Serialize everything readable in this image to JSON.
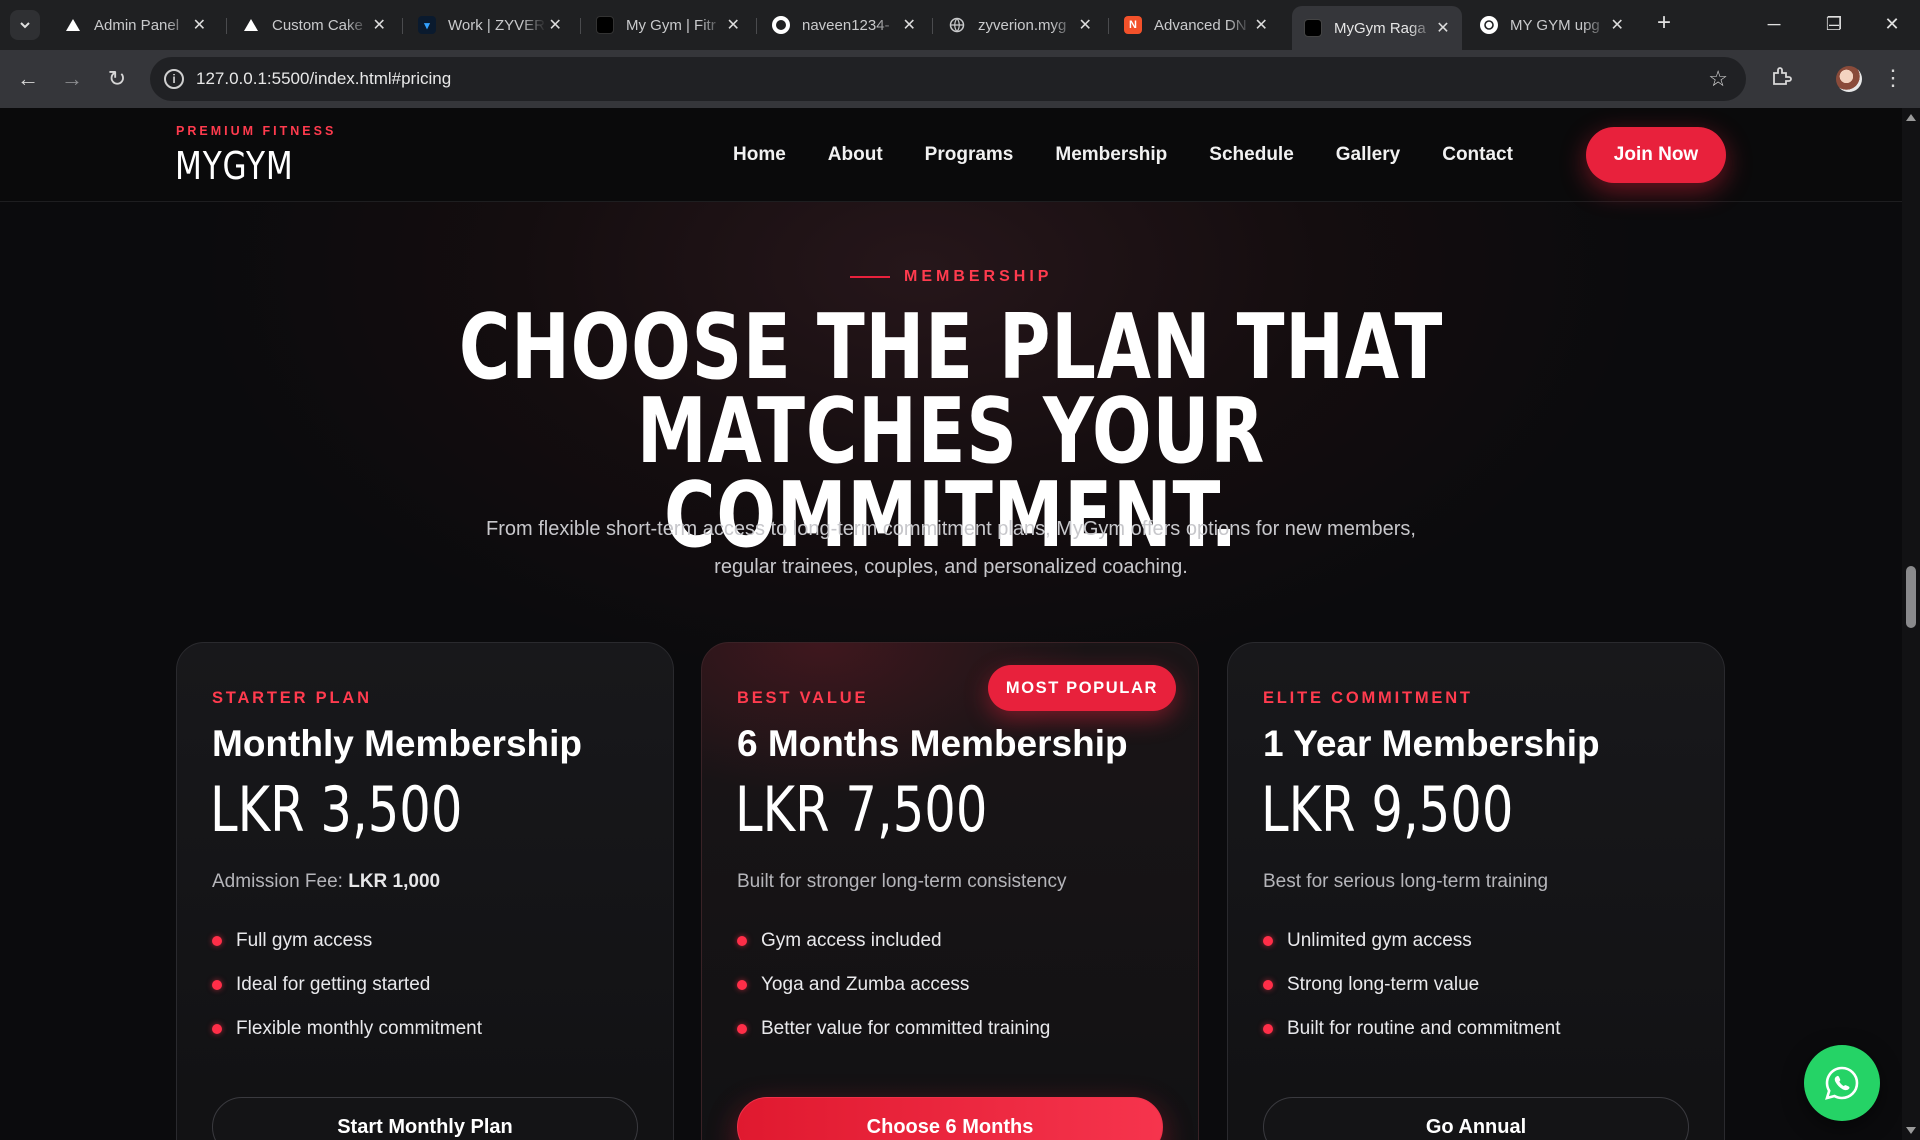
{
  "browser": {
    "tabs": [
      {
        "title": "Admin Panel",
        "favicon": "triangle-logo-icon",
        "active": false
      },
      {
        "title": "Custom Cake",
        "favicon": "triangle-logo-icon",
        "active": false
      },
      {
        "title": "Work | ZYVER",
        "favicon": "zyver-icon",
        "active": false
      },
      {
        "title": "My Gym | Fitr",
        "favicon": "mygym-icon",
        "active": false
      },
      {
        "title": "naveen1234-",
        "favicon": "github-icon",
        "active": false
      },
      {
        "title": "zyverion.myg",
        "favicon": "globe-icon",
        "active": false
      },
      {
        "title": "Advanced DN",
        "favicon": "n-logo-icon",
        "active": false
      },
      {
        "title": "MyGym Raga",
        "favicon": "mygym-icon",
        "active": true
      },
      {
        "title": "MY GYM upg",
        "favicon": "openai-icon",
        "active": false
      }
    ],
    "url": "127.0.0.1:5500/index.html#pricing"
  },
  "site": {
    "brand_tag": "PREMIUM FITNESS",
    "brand_name": "MYGYM",
    "nav": [
      "Home",
      "About",
      "Programs",
      "Membership",
      "Schedule",
      "Gallery",
      "Contact"
    ],
    "join_label": "Join Now"
  },
  "section": {
    "eyebrow": "MEMBERSHIP",
    "headline": "CHOOSE THE PLAN THAT MATCHES YOUR COMMITMENT.",
    "lead": "From flexible short-term access to long-term commitment plans, MyGym offers options for new members, regular trainees, couples, and personalized coaching."
  },
  "plans": [
    {
      "kicker": "STARTER PLAN",
      "name": "Monthly Membership",
      "price": "LKR 3,500",
      "sub_prefix": "Admission Fee: ",
      "sub_strong": "LKR 1,000",
      "features": [
        "Full gym access",
        "Ideal for getting started",
        "Flexible monthly commitment"
      ],
      "cta": "Start Monthly Plan"
    },
    {
      "kicker": "BEST VALUE",
      "badge": "MOST POPULAR",
      "name": "6 Months Membership",
      "price": "LKR 7,500",
      "sub_prefix": "Built for stronger long-term consistency",
      "sub_strong": "",
      "features": [
        "Gym access included",
        "Yoga and Zumba access",
        "Better value for committed training"
      ],
      "cta": "Choose 6 Months"
    },
    {
      "kicker": "ELITE COMMITMENT",
      "name": "1 Year Membership",
      "price": "LKR 9,500",
      "sub_prefix": "Best for serious long-term training",
      "sub_strong": "",
      "features": [
        "Unlimited gym access",
        "Strong long-term value",
        "Built for routine and commitment"
      ],
      "cta": "Go Annual"
    }
  ],
  "colors": {
    "accent": "#e8213c",
    "background": "#0b0b0d",
    "whatsapp": "#25d366"
  }
}
